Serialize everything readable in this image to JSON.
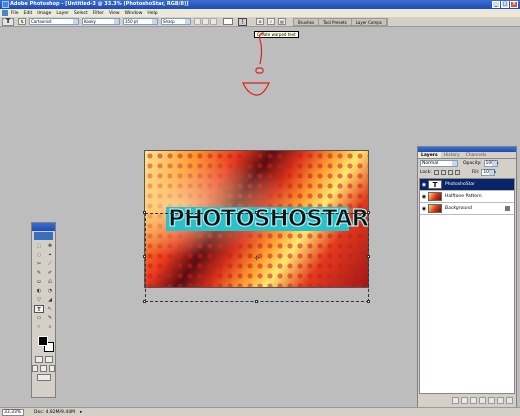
{
  "window": {
    "title": "Adobe Photoshop - [Untitled-3 @ 33.3% (PhotoshoStar, RGB/8)]"
  },
  "menu": [
    "File",
    "Edit",
    "Image",
    "Layer",
    "Select",
    "Filter",
    "View",
    "Window",
    "Help"
  ],
  "options_bar": {
    "tool_glyph": "T",
    "font_family": "Cartoonist",
    "font_style": "Kooky",
    "font_size": "350 pt",
    "antialias": "Sharp",
    "warp_tooltip": "Create warped text",
    "palette_well": [
      "Brushes",
      "Tool Presets",
      "Layer Comps"
    ]
  },
  "canvas": {
    "text": "PHOTOSHOSTAR"
  },
  "tools_palette": {
    "tools": [
      "⬚",
      "✥",
      "◌",
      "⌖",
      "✂",
      "⟋",
      "✎",
      "✐",
      "⛀",
      "⎌",
      "◐",
      "◔",
      "▽",
      "◢",
      "T",
      "↖",
      "▭",
      "✎",
      "☞",
      "⌕"
    ]
  },
  "layers_panel": {
    "tabs": [
      "Layers",
      "History",
      "Channels"
    ],
    "blend_mode": "Normal",
    "opacity_label": "Opacity:",
    "opacity_value": "100%",
    "lock_label": "Lock:",
    "fill_label": "Fill:",
    "fill_value": "100%",
    "layers": [
      {
        "name": "PhotoshoStar",
        "thumb": "T",
        "active": true
      },
      {
        "name": "Halftone Pattern",
        "thumb": "",
        "active": false
      },
      {
        "name": "Background",
        "thumb": "",
        "active": false
      }
    ]
  },
  "status_bar": {
    "zoom": "33.33%",
    "doc_size": "Doc: 4.82M/9.44M",
    "arrow": "▸"
  },
  "colors": {
    "title_bar": "#1d4bb6",
    "text_highlight": "#2bc1c9",
    "annotation": "#e02020"
  }
}
